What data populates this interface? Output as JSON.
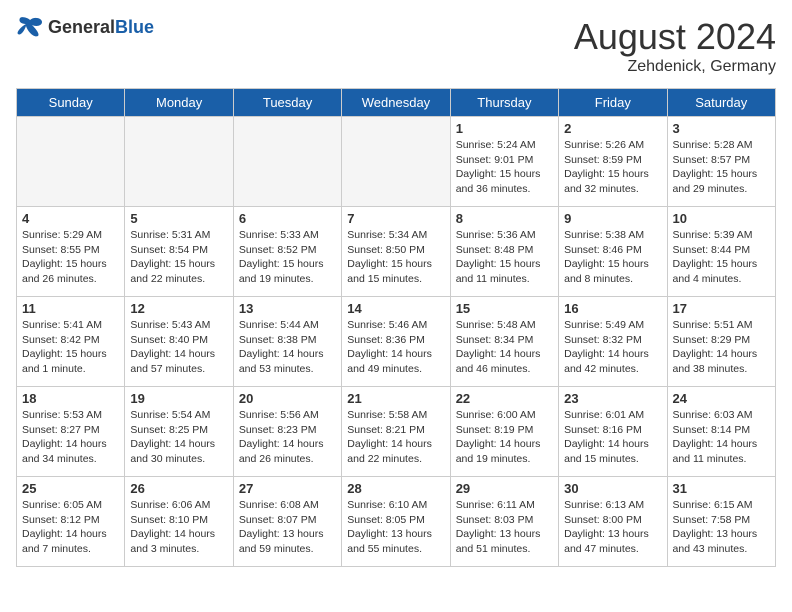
{
  "header": {
    "logo_general": "General",
    "logo_blue": "Blue",
    "month_year": "August 2024",
    "location": "Zehdenick, Germany"
  },
  "days_of_week": [
    "Sunday",
    "Monday",
    "Tuesday",
    "Wednesday",
    "Thursday",
    "Friday",
    "Saturday"
  ],
  "weeks": [
    [
      {
        "day": "",
        "info": ""
      },
      {
        "day": "",
        "info": ""
      },
      {
        "day": "",
        "info": ""
      },
      {
        "day": "",
        "info": ""
      },
      {
        "day": "1",
        "info": "Sunrise: 5:24 AM\nSunset: 9:01 PM\nDaylight: 15 hours\nand 36 minutes."
      },
      {
        "day": "2",
        "info": "Sunrise: 5:26 AM\nSunset: 8:59 PM\nDaylight: 15 hours\nand 32 minutes."
      },
      {
        "day": "3",
        "info": "Sunrise: 5:28 AM\nSunset: 8:57 PM\nDaylight: 15 hours\nand 29 minutes."
      }
    ],
    [
      {
        "day": "4",
        "info": "Sunrise: 5:29 AM\nSunset: 8:55 PM\nDaylight: 15 hours\nand 26 minutes."
      },
      {
        "day": "5",
        "info": "Sunrise: 5:31 AM\nSunset: 8:54 PM\nDaylight: 15 hours\nand 22 minutes."
      },
      {
        "day": "6",
        "info": "Sunrise: 5:33 AM\nSunset: 8:52 PM\nDaylight: 15 hours\nand 19 minutes."
      },
      {
        "day": "7",
        "info": "Sunrise: 5:34 AM\nSunset: 8:50 PM\nDaylight: 15 hours\nand 15 minutes."
      },
      {
        "day": "8",
        "info": "Sunrise: 5:36 AM\nSunset: 8:48 PM\nDaylight: 15 hours\nand 11 minutes."
      },
      {
        "day": "9",
        "info": "Sunrise: 5:38 AM\nSunset: 8:46 PM\nDaylight: 15 hours\nand 8 minutes."
      },
      {
        "day": "10",
        "info": "Sunrise: 5:39 AM\nSunset: 8:44 PM\nDaylight: 15 hours\nand 4 minutes."
      }
    ],
    [
      {
        "day": "11",
        "info": "Sunrise: 5:41 AM\nSunset: 8:42 PM\nDaylight: 15 hours\nand 1 minute."
      },
      {
        "day": "12",
        "info": "Sunrise: 5:43 AM\nSunset: 8:40 PM\nDaylight: 14 hours\nand 57 minutes."
      },
      {
        "day": "13",
        "info": "Sunrise: 5:44 AM\nSunset: 8:38 PM\nDaylight: 14 hours\nand 53 minutes."
      },
      {
        "day": "14",
        "info": "Sunrise: 5:46 AM\nSunset: 8:36 PM\nDaylight: 14 hours\nand 49 minutes."
      },
      {
        "day": "15",
        "info": "Sunrise: 5:48 AM\nSunset: 8:34 PM\nDaylight: 14 hours\nand 46 minutes."
      },
      {
        "day": "16",
        "info": "Sunrise: 5:49 AM\nSunset: 8:32 PM\nDaylight: 14 hours\nand 42 minutes."
      },
      {
        "day": "17",
        "info": "Sunrise: 5:51 AM\nSunset: 8:29 PM\nDaylight: 14 hours\nand 38 minutes."
      }
    ],
    [
      {
        "day": "18",
        "info": "Sunrise: 5:53 AM\nSunset: 8:27 PM\nDaylight: 14 hours\nand 34 minutes."
      },
      {
        "day": "19",
        "info": "Sunrise: 5:54 AM\nSunset: 8:25 PM\nDaylight: 14 hours\nand 30 minutes."
      },
      {
        "day": "20",
        "info": "Sunrise: 5:56 AM\nSunset: 8:23 PM\nDaylight: 14 hours\nand 26 minutes."
      },
      {
        "day": "21",
        "info": "Sunrise: 5:58 AM\nSunset: 8:21 PM\nDaylight: 14 hours\nand 22 minutes."
      },
      {
        "day": "22",
        "info": "Sunrise: 6:00 AM\nSunset: 8:19 PM\nDaylight: 14 hours\nand 19 minutes."
      },
      {
        "day": "23",
        "info": "Sunrise: 6:01 AM\nSunset: 8:16 PM\nDaylight: 14 hours\nand 15 minutes."
      },
      {
        "day": "24",
        "info": "Sunrise: 6:03 AM\nSunset: 8:14 PM\nDaylight: 14 hours\nand 11 minutes."
      }
    ],
    [
      {
        "day": "25",
        "info": "Sunrise: 6:05 AM\nSunset: 8:12 PM\nDaylight: 14 hours\nand 7 minutes."
      },
      {
        "day": "26",
        "info": "Sunrise: 6:06 AM\nSunset: 8:10 PM\nDaylight: 14 hours\nand 3 minutes."
      },
      {
        "day": "27",
        "info": "Sunrise: 6:08 AM\nSunset: 8:07 PM\nDaylight: 13 hours\nand 59 minutes."
      },
      {
        "day": "28",
        "info": "Sunrise: 6:10 AM\nSunset: 8:05 PM\nDaylight: 13 hours\nand 55 minutes."
      },
      {
        "day": "29",
        "info": "Sunrise: 6:11 AM\nSunset: 8:03 PM\nDaylight: 13 hours\nand 51 minutes."
      },
      {
        "day": "30",
        "info": "Sunrise: 6:13 AM\nSunset: 8:00 PM\nDaylight: 13 hours\nand 47 minutes."
      },
      {
        "day": "31",
        "info": "Sunrise: 6:15 AM\nSunset: 7:58 PM\nDaylight: 13 hours\nand 43 minutes."
      }
    ]
  ]
}
